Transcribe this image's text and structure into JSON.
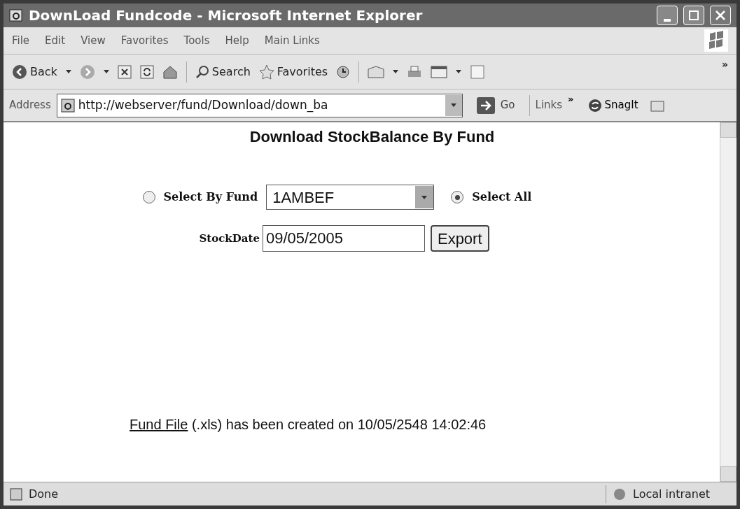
{
  "window": {
    "title": "DownLoad Fundcode - Microsoft Internet Explorer"
  },
  "menu": [
    "File",
    "Edit",
    "View",
    "Favorites",
    "Tools",
    "Help",
    "Main Links"
  ],
  "toolbar": {
    "back": "Back",
    "search": "Search",
    "favorites": "Favorites",
    "more": "»"
  },
  "address_bar": {
    "label": "Address",
    "url": "http://webserver/fund/Download/down_ba",
    "go": "Go",
    "links": "Links",
    "links_more": "»",
    "snagit": "SnagIt"
  },
  "page": {
    "heading": "Download StockBalance By Fund",
    "options": [
      {
        "label": "Select By Fund",
        "selected": false
      },
      {
        "label": "Select All",
        "selected": true
      }
    ],
    "fund_select": {
      "value": "1AMBEF"
    },
    "stock_date": {
      "label": "StockDate",
      "value": "09/05/2005"
    },
    "export_button": "Export",
    "message": {
      "link": "Fund File",
      "text": " (.xls) has been created on 10/05/2548 14:02:46"
    }
  },
  "status_bar": {
    "text": "Done",
    "zone": "Local intranet"
  }
}
